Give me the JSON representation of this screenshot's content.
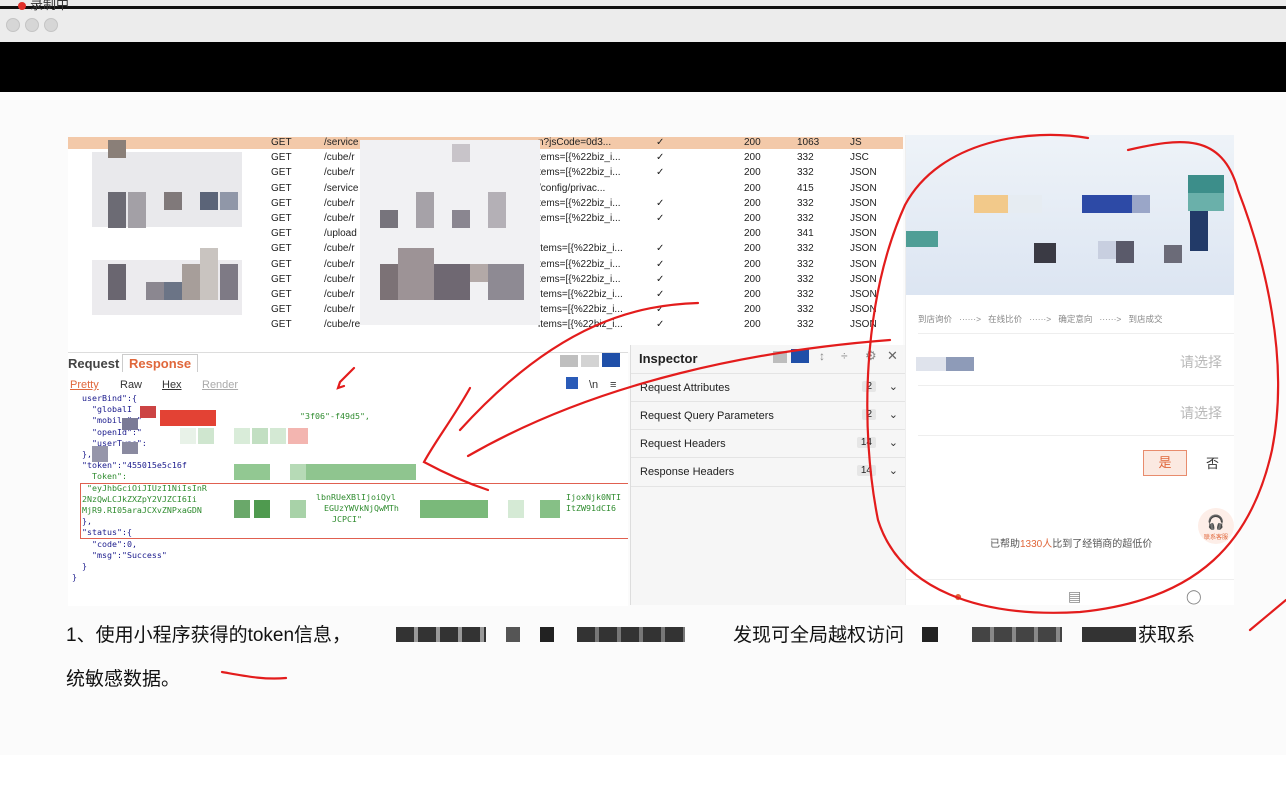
{
  "recording_label": "录制中",
  "traffic": {
    "rows": [
      {
        "method": "GET",
        "path": "/service",
        "query": "n?jsCode=0d3...",
        "check": "✓",
        "status": "200",
        "size": "1063",
        "type": "JS",
        "selected": true
      },
      {
        "method": "GET",
        "path": "/cube/r",
        "query": "tems=[{%22biz_i...",
        "check": "✓",
        "status": "200",
        "size": "332",
        "type": "JSC"
      },
      {
        "method": "GET",
        "path": "/cube/r",
        "query": "tems=[{%22biz_i...",
        "check": "✓",
        "status": "200",
        "size": "332",
        "type": "JSON"
      },
      {
        "method": "GET",
        "path": "/service",
        "query": "/config/privac...",
        "check": "",
        "status": "200",
        "size": "415",
        "type": "JSON"
      },
      {
        "method": "GET",
        "path": "/cube/r",
        "query": "tems=[{%22biz_i...",
        "check": "✓",
        "status": "200",
        "size": "332",
        "type": "JSON"
      },
      {
        "method": "GET",
        "path": "/cube/r",
        "query": "tems=[{%22biz_i...",
        "check": "✓",
        "status": "200",
        "size": "332",
        "type": "JSON"
      },
      {
        "method": "GET",
        "path": "/upload",
        "query": "",
        "check": "",
        "status": "200",
        "size": "341",
        "type": "JSON"
      },
      {
        "method": "GET",
        "path": "/cube/r",
        "query": "items=[{%22biz_i...",
        "check": "✓",
        "status": "200",
        "size": "332",
        "type": "JSON"
      },
      {
        "method": "GET",
        "path": "/cube/r",
        "query": "tems=[{%22biz_i...",
        "check": "✓",
        "status": "200",
        "size": "332",
        "type": "JSON"
      },
      {
        "method": "GET",
        "path": "/cube/r",
        "query": "tems=[{%22biz_i...",
        "check": "✓",
        "status": "200",
        "size": "332",
        "type": "JSON"
      },
      {
        "method": "GET",
        "path": "/cube/r",
        "query": "items=[{%22biz_i...",
        "check": "✓",
        "status": "200",
        "size": "332",
        "type": "JSON"
      },
      {
        "method": "GET",
        "path": "/cube/r",
        "query": "items=[{%22biz_i...",
        "check": "✓",
        "status": "200",
        "size": "332",
        "type": "JSON"
      },
      {
        "method": "GET",
        "path": "/cube/re",
        "query": "items=[{%22biz_i...",
        "check": "✓",
        "status": "200",
        "size": "332",
        "type": "JSON"
      }
    ]
  },
  "request_panel": {
    "tab_request": "Request",
    "tab_response": "Response",
    "subtabs": [
      "Pretty",
      "Raw",
      "Hex",
      "Render"
    ],
    "newline_toggle": "\\n",
    "code_lines": [
      "  userBind\":{",
      "    \"globalI",
      "    \"mobile\":\"",
      "    \"openId\":\"",
      "    \"userType\":",
      "  },",
      "  \"token\":\"455015e5c16f",
      "    Token\":",
      "   \"eyJhbGciOiJIUzI1NiIsInR",
      "  2NzQwLCJkZXZpY2VJZCI6Ii",
      "  MjR9.RI05araJCXvZNPxaGDN",
      "  },",
      "  \"status\":{",
      "    \"code\":0,",
      "    \"msg\":\"Success\"",
      "  }",
      "}"
    ],
    "code_fragments": {
      "uuid_tail": "\"3f06\"-f49d5\",",
      "jwt_mid": "lbnRUeXBlIjoiQyl",
      "jwt_right": "IjoxNjk0NTI",
      "jwt_mid2": "EGUzYWVkNjQwMTh",
      "jwt_right2": "ItZW91dCI6",
      "jwt_mid3": "JCPCI\""
    }
  },
  "inspector": {
    "title": "Inspector",
    "sections": [
      {
        "label": "Request Attributes",
        "count": "2"
      },
      {
        "label": "Request Query Parameters",
        "count": "2"
      },
      {
        "label": "Request Headers",
        "count": "14"
      },
      {
        "label": "Response Headers",
        "count": "14"
      }
    ]
  },
  "phone": {
    "steps": [
      "到店询价",
      "······>",
      "在线比价",
      "······>",
      "确定意向",
      "······>",
      "到店成交"
    ],
    "select_placeholder": "请选择",
    "yes_label": "是",
    "no_label": "否",
    "helped_prefix": "已帮助",
    "helped_count": "1330人",
    "helped_suffix": "比到了经销商的超低价",
    "service_label": "联系客服"
  },
  "caption": {
    "line1_a": "1、使用小程序获得的token信息，",
    "line1_b": "发现可全局越权访问",
    "line1_c": "获取系",
    "line2": "统敏感数据。"
  },
  "colors": {
    "accent": "#e0673b",
    "annotation_red": "#e31c1c",
    "selected_row": "#f3c9a9"
  }
}
